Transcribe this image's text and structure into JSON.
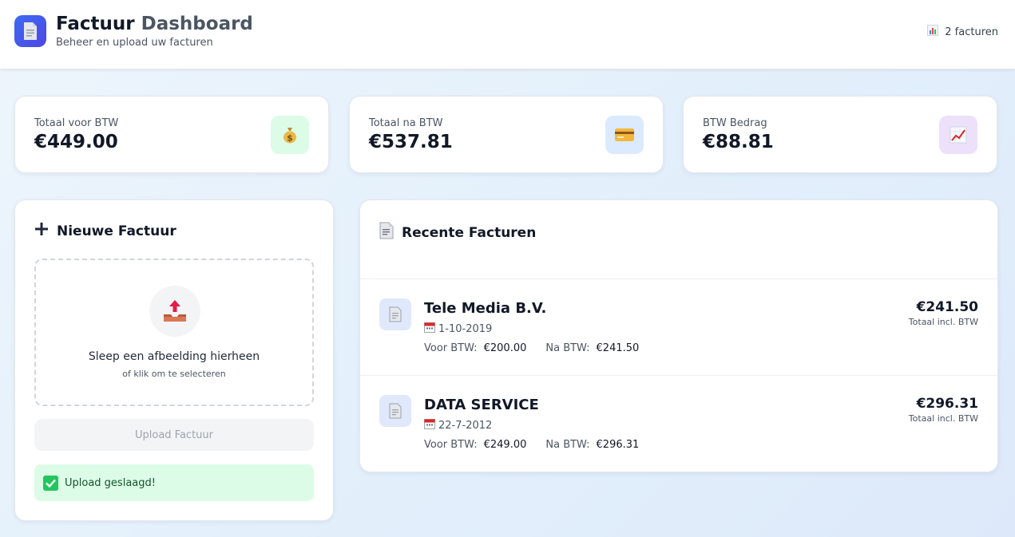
{
  "header": {
    "title_part1": "Factuur",
    "title_part2": "Dashboard",
    "subtitle": "Beheer en upload uw facturen",
    "invoice_count": "2 facturen",
    "logo_icon": "document-icon",
    "count_icon": "bar-chart-icon"
  },
  "stats": [
    {
      "label": "Totaal voor BTW",
      "value": "€449.00",
      "icon": "money-bag-icon",
      "icon_bg": "#dcfce7"
    },
    {
      "label": "Totaal na BTW",
      "value": "€537.81",
      "icon": "credit-card-icon",
      "icon_bg": "#dbeafe"
    },
    {
      "label": "BTW Bedrag",
      "value": "€88.81",
      "icon": "chart-increasing-icon",
      "icon_bg": "#ede0fb"
    }
  ],
  "upload_panel": {
    "title": "Nieuwe Factuur",
    "drop_main": "Sleep een afbeelding hierheen",
    "drop_sub": "of klik om te selecteren",
    "button_label": "Upload Factuur",
    "success_message": "Upload geslaagd!"
  },
  "recent_panel": {
    "title": "Recente Facturen",
    "invoices": [
      {
        "name": "Tele Media B.V.",
        "date": "1-10-2019",
        "before_label": "Voor BTW:",
        "before_value": "€200.00",
        "after_label": "Na BTW:",
        "after_value": "€241.50",
        "total": "€241.50",
        "total_label": "Totaal incl. BTW"
      },
      {
        "name": "DATA SERVICE",
        "date": "22-7-2012",
        "before_label": "Voor BTW:",
        "before_value": "€249.00",
        "after_label": "Na BTW:",
        "after_value": "€296.31",
        "total": "€296.31",
        "total_label": "Totaal incl. BTW"
      }
    ]
  },
  "colors": {
    "accent": "#3b6cf0",
    "success_bg": "#dcfce7",
    "success_text": "#14532d"
  }
}
